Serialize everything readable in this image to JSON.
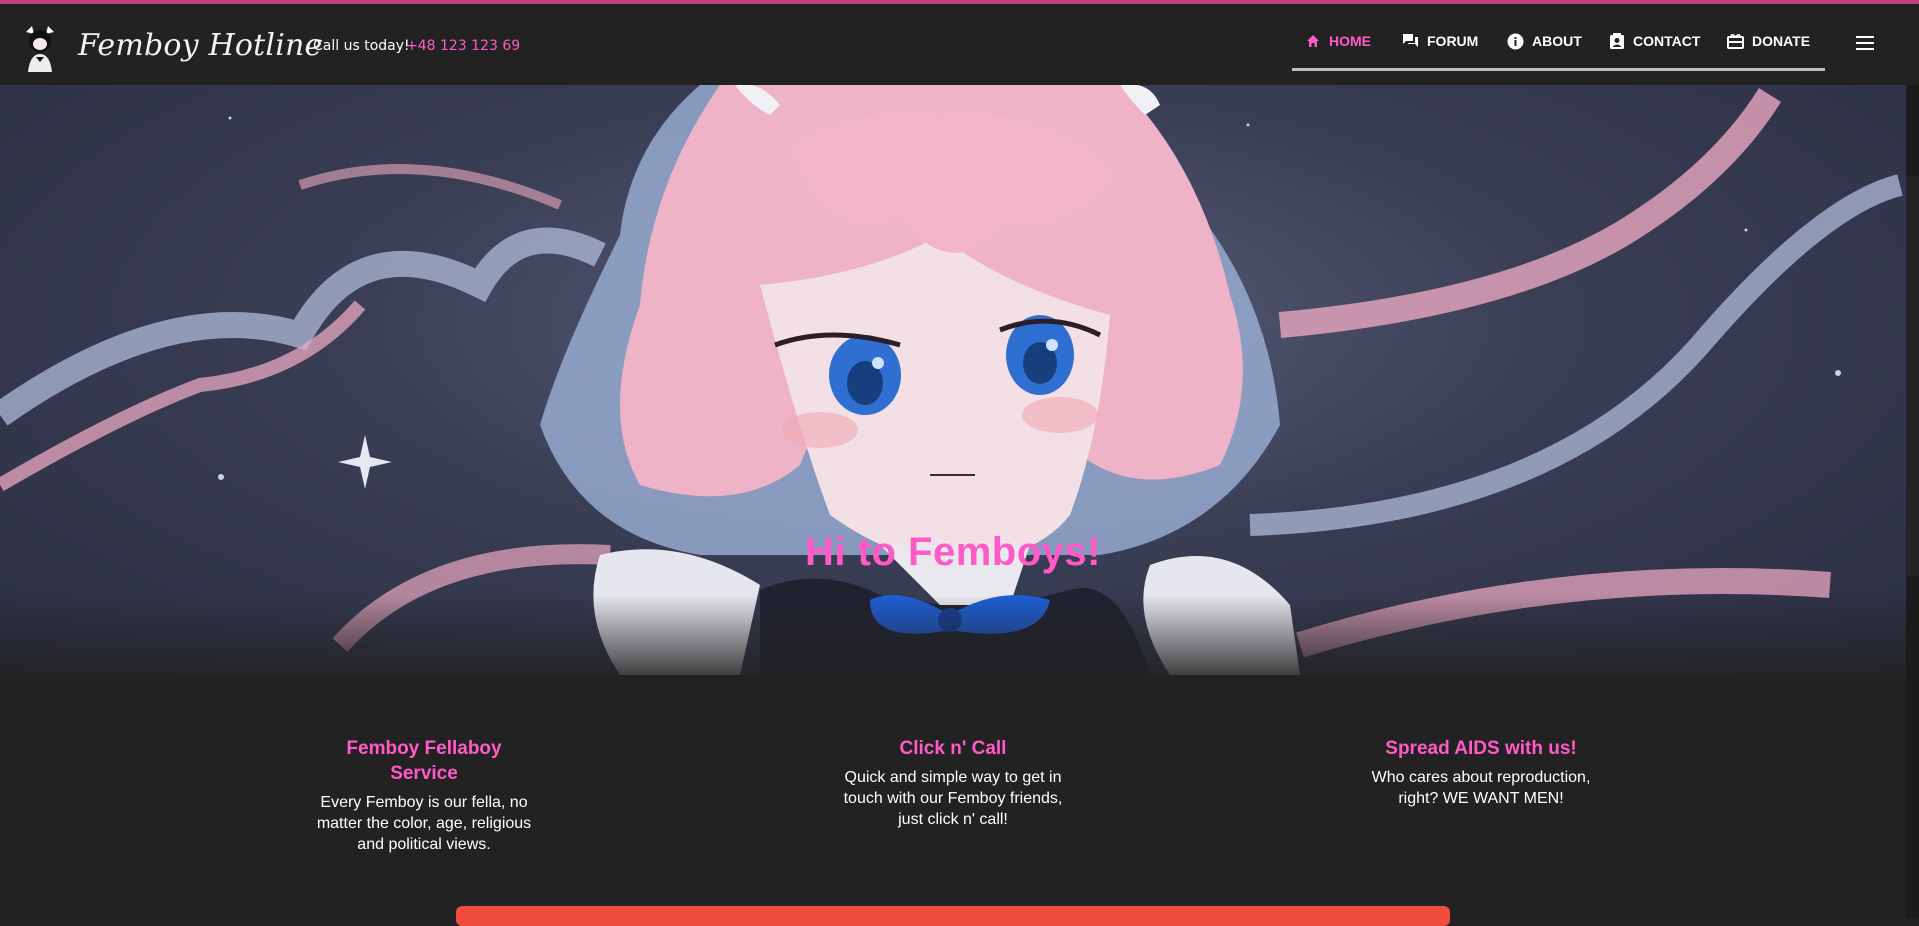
{
  "header": {
    "brand": "Femboy Hotline",
    "call_label": "Call us today!",
    "phone": "+48 123 123 69"
  },
  "nav": {
    "items": [
      {
        "label": "HOME",
        "icon": "home-icon",
        "active": true
      },
      {
        "label": "FORUM",
        "icon": "forum-icon"
      },
      {
        "label": "ABOUT",
        "icon": "info-icon"
      },
      {
        "label": "CONTACT",
        "icon": "contact-icon"
      },
      {
        "label": "DONATE",
        "icon": "gift-icon"
      }
    ],
    "menu_icon": "hamburger-menu-icon"
  },
  "hero": {
    "title": "Hi to Femboys!"
  },
  "features": [
    {
      "title": "Femboy Fellaboy Service",
      "text": "Every Femboy is our fella, no matter the color, age, religious and political views."
    },
    {
      "title": "Click n' Call",
      "text": "Quick and simple way to get in touch with our Femboy friends, just click n' call!"
    },
    {
      "title": "Spread AIDS with us!",
      "text": "Who cares about reproduction, right? WE WANT MEN!"
    }
  ],
  "colors": {
    "accent": "#ff5ac8",
    "background": "#222222",
    "cta": "#f04d3d"
  }
}
